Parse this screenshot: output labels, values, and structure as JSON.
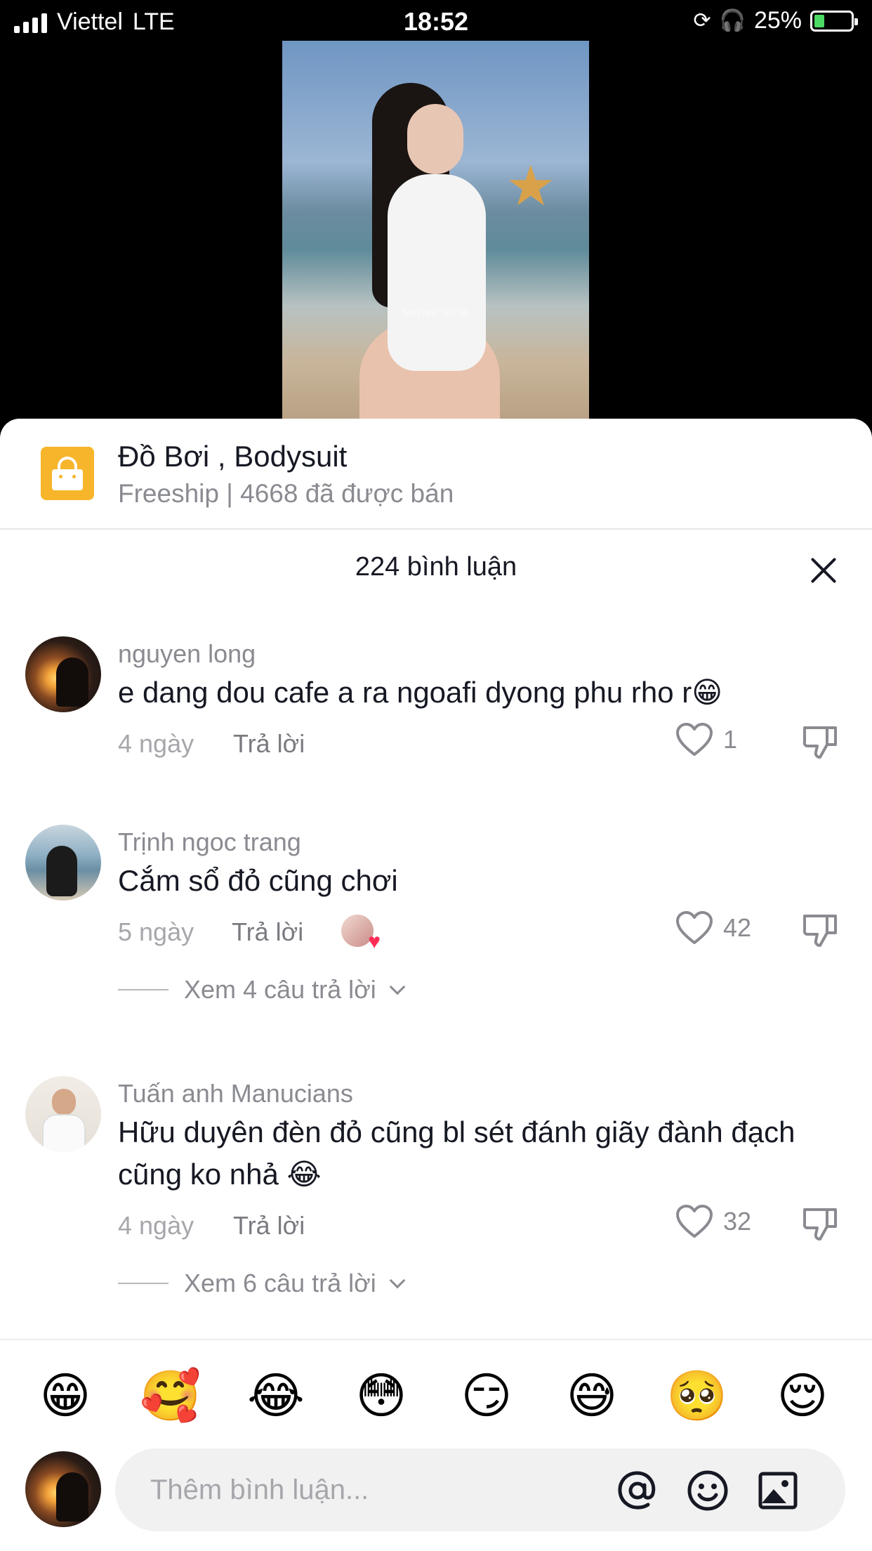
{
  "status_bar": {
    "carrier": "Viettel",
    "network": "LTE",
    "time": "18:52",
    "battery": "25%",
    "battery_level": 0.25
  },
  "video": {
    "watermark": "SAO NAY VAT VA"
  },
  "product": {
    "title": "Đồ Bơi , Bodysuit",
    "subtitle": "Freeship | 4668 đã được bán",
    "icon": "shopping-bag-icon",
    "accent": "#f7b52b"
  },
  "comments_panel": {
    "header": "224 bình luận",
    "close_icon": "close-icon"
  },
  "comments": [
    {
      "name": "nguyen long",
      "text": "e dang dou cafe a ra ngoafi dyong phu rho r😁",
      "time": "4 ngày",
      "reply_label": "Trả lời",
      "likes": "1"
    },
    {
      "name": "Trịnh ngoc trang",
      "text": "Cắm sổ đỏ cũng chơi",
      "time": "5 ngày",
      "reply_label": "Trả lời",
      "likes": "42",
      "view_replies": "Xem 4 câu trả lời"
    },
    {
      "name": "Tuấn anh Manucians",
      "text": "Hữu duyên đèn đỏ cũng bl sét đánh giãy đành đạch cũng ko nhả 😂",
      "time": "4 ngày",
      "reply_label": "Trả lời",
      "likes": "32",
      "view_replies": "Xem 6 câu trả lời"
    }
  ],
  "emoji_bar": [
    "😁",
    "🥰",
    "😂",
    "😳",
    "😏",
    "😅",
    "🥺",
    "😌"
  ],
  "composer": {
    "placeholder": "Thêm bình luận...",
    "mention_icon": "at-icon",
    "emoji_icon": "smiley-icon",
    "image_icon": "image-icon"
  },
  "colors": {
    "like_accent": "#fe2c55",
    "text_primary": "#161823",
    "text_secondary": "#8a8b91"
  }
}
